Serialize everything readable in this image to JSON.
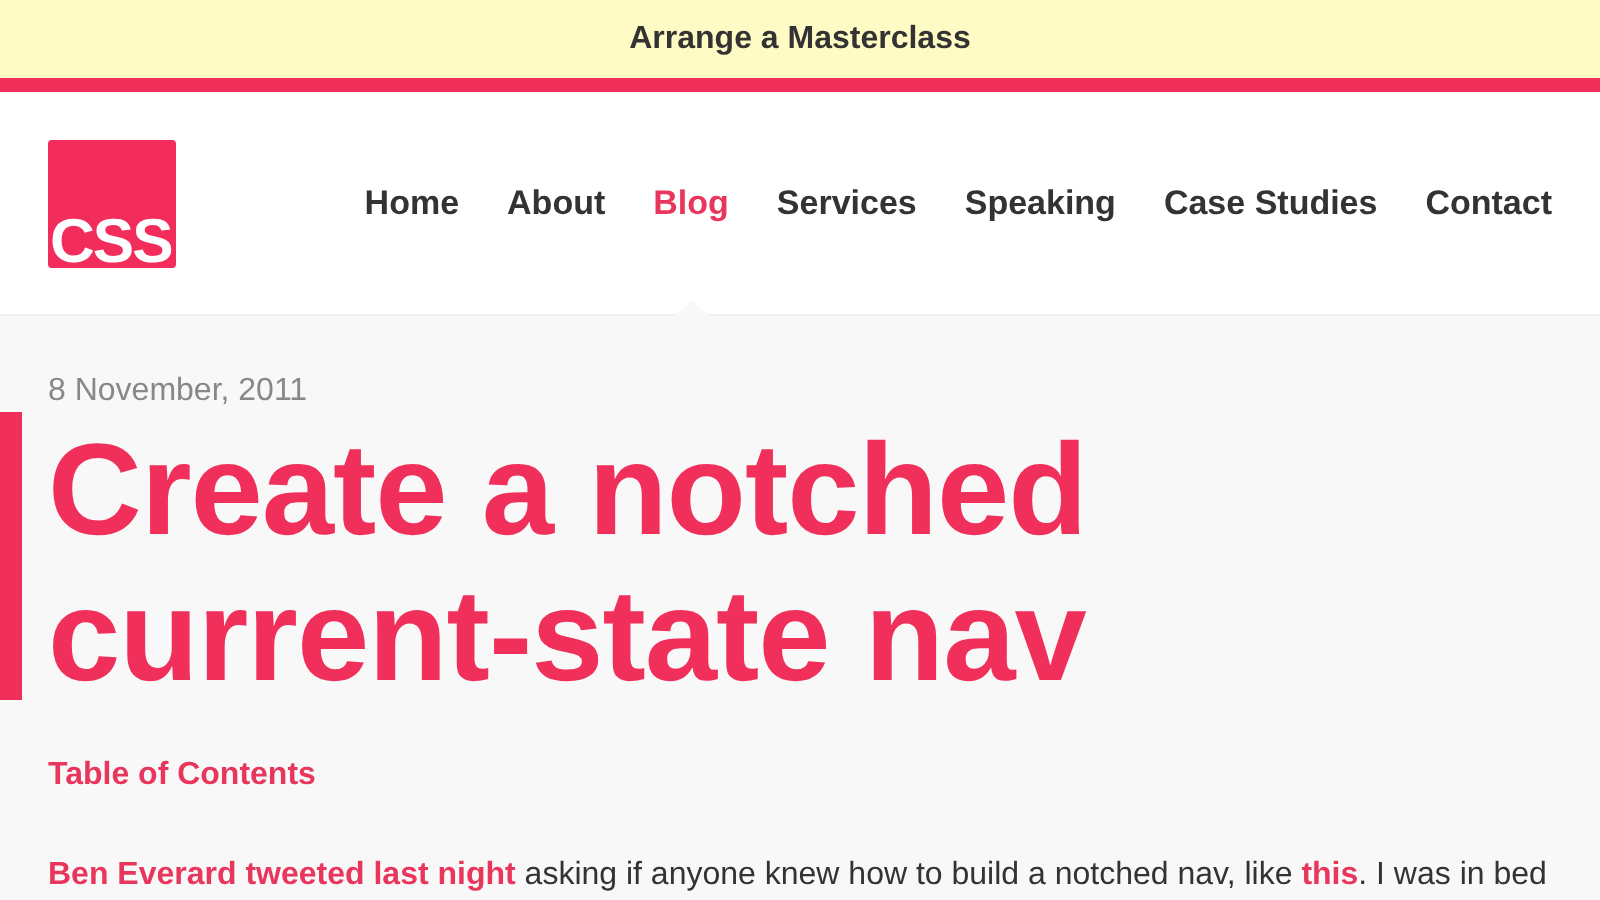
{
  "banner": {
    "text": "Arrange a Masterclass"
  },
  "logo": {
    "text": "CSS"
  },
  "nav": [
    {
      "label": "Home",
      "selected": false
    },
    {
      "label": "About",
      "selected": false
    },
    {
      "label": "Blog",
      "selected": true
    },
    {
      "label": "Services",
      "selected": false
    },
    {
      "label": "Speaking",
      "selected": false
    },
    {
      "label": "Case Studies",
      "selected": false
    },
    {
      "label": "Contact",
      "selected": false
    }
  ],
  "article": {
    "date": "8 November, 2011",
    "title": "Create a notched current-state nav",
    "toc_link": "Table of Contents",
    "paragraph": [
      {
        "kind": "link",
        "text": "Ben Everard tweeted last night"
      },
      {
        "kind": "text",
        "text": " asking if anyone knew how to build a notched nav, like "
      },
      {
        "kind": "link",
        "text": "this"
      },
      {
        "kind": "text",
        "text": ". I was in bed"
      }
    ]
  }
}
